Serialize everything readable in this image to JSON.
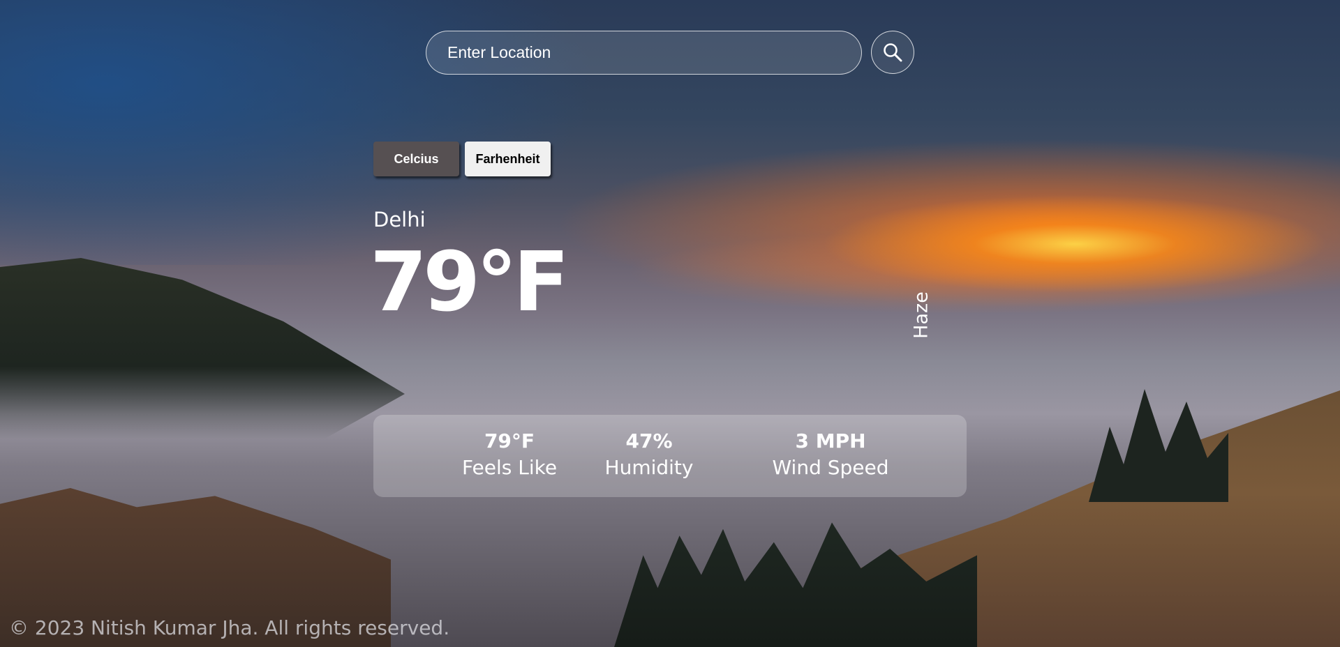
{
  "search": {
    "placeholder": "Enter Location",
    "button_icon": "search-icon"
  },
  "units": {
    "celsius_label": "Celcius",
    "fahrenheit_label": "Farhenheit",
    "active": "Celcius"
  },
  "weather": {
    "city": "Delhi",
    "temperature": "79°F",
    "condition": "Haze"
  },
  "stats": [
    {
      "value": "79°F",
      "label": "Feels Like"
    },
    {
      "value": "47%",
      "label": "Humidity"
    },
    {
      "value": "3 MPH",
      "label": "Wind Speed"
    }
  ],
  "footer": {
    "text": "© 2023 Nitish Kumar Jha. All rights reserved."
  },
  "colors": {
    "celsius_bg": "#565052",
    "fahrenheit_bg": "#f0f0f0"
  }
}
